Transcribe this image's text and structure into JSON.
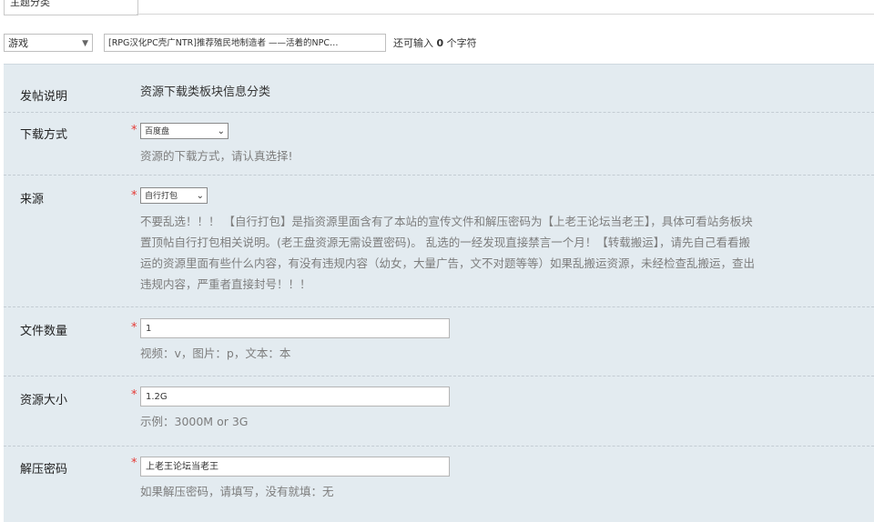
{
  "top_tab": {
    "label": "主题分类"
  },
  "title_bar": {
    "type_select": "游戏",
    "subject_value": "[RPG汉化PC壳广NTR]推荐殖民地制造者 ——活着的NPC…",
    "counter_prefix": "还可输入",
    "counter_value": "0",
    "counter_suffix": "个字符"
  },
  "form": {
    "intro": {
      "label": "发帖说明",
      "text": "资源下载类板块信息分类"
    },
    "download_method": {
      "label": "下载方式",
      "required": "*",
      "selected": "百度盘",
      "hint": "资源的下载方式，请认真选择!"
    },
    "source": {
      "label": "来源",
      "required": "*",
      "selected": "自行打包",
      "hint_lines": [
        "不要乱选！！！ 【自行打包】是指资源里面含有了本站的宣传文件和解压密码为【上老王论坛当老王】，具体可看站务板块",
        "置顶帖自行打包相关说明。(老王盘资源无需设置密码)。 乱选的一经发现直接禁言一个月！【转载搬运】，请先自己看看搬",
        "运的资源里面有些什么内容，有没有违规内容（幼女，大量广告，文不对题等等）如果乱搬运资源，未经检查乱搬运，查出",
        "违规内容，严重者直接封号！！！"
      ]
    },
    "file_count": {
      "label": "文件数量",
      "required": "*",
      "value": "1",
      "hint": "视频：v，图片：p，文本：本"
    },
    "resource_size": {
      "label": "资源大小",
      "required": "*",
      "value": "1.2G",
      "hint": "示例：3000M or 3G"
    },
    "unzip_password": {
      "label": "解压密码",
      "required": "*",
      "value": "上老王论坛当老王",
      "hint": "如果解压密码，请填写，没有就填：无"
    }
  }
}
